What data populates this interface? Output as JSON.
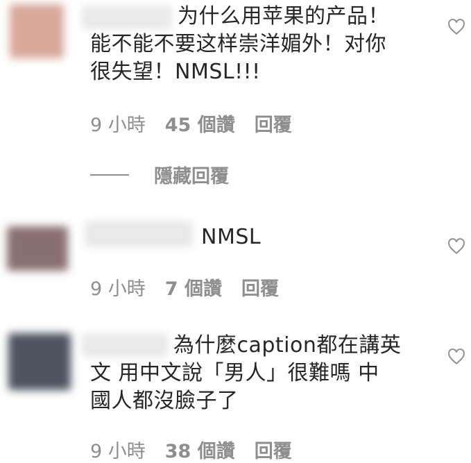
{
  "comments": [
    {
      "text": "为什么用苹果的产品！\n能不能不要这样崇洋媚外！对你\n很失望！NMSL!!!",
      "time": "9 小時",
      "likes": "45 個讚",
      "reply": "回覆",
      "hide_replies": "隱藏回覆"
    },
    {
      "text": "NMSL",
      "time": "9 小時",
      "likes": "7 個讚",
      "reply": "回覆"
    },
    {
      "text": "為什麼caption都在講英\n文 用中文說「男人」很難嗎 中\n國人都沒臉子了",
      "time": "9 小時",
      "likes": "38 個讚",
      "reply": "回覆"
    }
  ],
  "colors": {
    "text": "#262626",
    "meta": "#8e8e8e",
    "avatar1": "#d9a79a",
    "avatar2": "#8a6f72",
    "avatar3": "#4e5360"
  },
  "icons": [
    "heart-icon"
  ]
}
